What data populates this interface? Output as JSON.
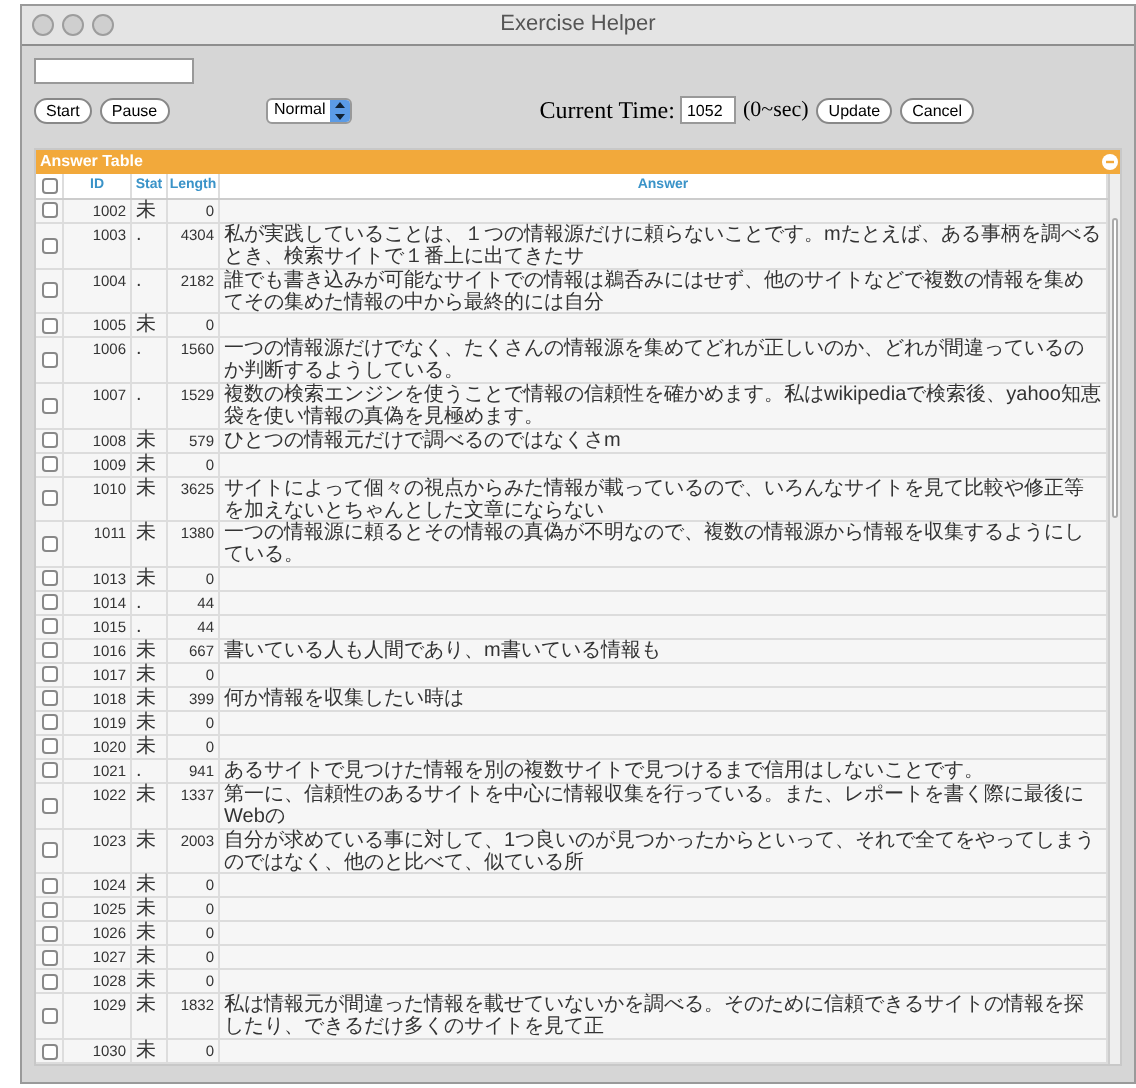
{
  "window": {
    "title": "Exercise Helper"
  },
  "controls": {
    "buttons_left": [
      "Start",
      "Pause"
    ],
    "speed_select": "Normal",
    "time_label": "Current Time:",
    "time_value": "1052",
    "time_unit": "(0~sec)",
    "buttons_right": [
      "Update",
      "Cancel"
    ]
  },
  "table": {
    "title": "Answer Table",
    "header_checked": false,
    "columns": [
      "ID",
      "Stat",
      "Length",
      "Answer"
    ],
    "rows": [
      {
        "checked": false,
        "id": "1002",
        "stat": "未",
        "length": "0",
        "answer": ""
      },
      {
        "checked": false,
        "id": "1003",
        "stat": ".",
        "length": "4304",
        "answer": "私が実践していることは、１つの情報源だけに頼らないことです。mたとえば、ある事柄を調べるとき、検索サイトで１番上に出てきたサ"
      },
      {
        "checked": false,
        "id": "1004",
        "stat": ".",
        "length": "2182",
        "answer": "誰でも書き込みが可能なサイトでの情報は鵜呑みにはせず、他のサイトなどで複数の情報を集めてその集めた情報の中から最終的には自分"
      },
      {
        "checked": false,
        "id": "1005",
        "stat": "未",
        "length": "0",
        "answer": ""
      },
      {
        "checked": false,
        "id": "1006",
        "stat": ".",
        "length": "1560",
        "answer": "一つの情報源だけでなく、たくさんの情報源を集めてどれが正しいのか、どれが間違っているのか判断するようしている。"
      },
      {
        "checked": false,
        "id": "1007",
        "stat": ".",
        "length": "1529",
        "answer": "複数の検索エンジンを使うことで情報の信頼性を確かめます。私はwikipediaで検索後、yahoo知恵袋を使い情報の真偽を見極めます。"
      },
      {
        "checked": false,
        "id": "1008",
        "stat": "未",
        "length": "579",
        "answer": "ひとつの情報元だけで調べるのではなくさm"
      },
      {
        "checked": false,
        "id": "1009",
        "stat": "未",
        "length": "0",
        "answer": ""
      },
      {
        "checked": false,
        "id": "1010",
        "stat": "未",
        "length": "3625",
        "answer": "サイトによって個々の視点からみた情報が載っているので、いろんなサイトを見て比較や修正等を加えないとちゃんとした文章にならない"
      },
      {
        "checked": false,
        "id": "1011",
        "stat": "未",
        "length": "1380",
        "answer": "一つの情報源に頼るとその情報の真偽が不明なので、複数の情報源から情報を収集するようにしている。"
      },
      {
        "checked": false,
        "id": "1013",
        "stat": "未",
        "length": "0",
        "answer": ""
      },
      {
        "checked": false,
        "id": "1014",
        "stat": ".",
        "length": "44",
        "answer": ""
      },
      {
        "checked": false,
        "id": "1015",
        "stat": ".",
        "length": "44",
        "answer": ""
      },
      {
        "checked": false,
        "id": "1016",
        "stat": "未",
        "length": "667",
        "answer": "書いている人も人間であり、m書いている情報も"
      },
      {
        "checked": false,
        "id": "1017",
        "stat": "未",
        "length": "0",
        "answer": ""
      },
      {
        "checked": false,
        "id": "1018",
        "stat": "未",
        "length": "399",
        "answer": "何か情報を収集したい時は"
      },
      {
        "checked": false,
        "id": "1019",
        "stat": "未",
        "length": "0",
        "answer": ""
      },
      {
        "checked": false,
        "id": "1020",
        "stat": "未",
        "length": "0",
        "answer": ""
      },
      {
        "checked": false,
        "id": "1021",
        "stat": ".",
        "length": "941",
        "answer": "あるサイトで見つけた情報を別の複数サイトで見つけるまで信用はしないことです。"
      },
      {
        "checked": false,
        "id": "1022",
        "stat": "未",
        "length": "1337",
        "answer": "第一に、信頼性のあるサイトを中心に情報収集を行っている。また、レポートを書く際に最後にWebの"
      },
      {
        "checked": false,
        "id": "1023",
        "stat": "未",
        "length": "2003",
        "answer": "自分が求めている事に対して、1つ良いのが見つかったからといって、それで全てをやってしまうのではなく、他のと比べて、似ている所"
      },
      {
        "checked": false,
        "id": "1024",
        "stat": "未",
        "length": "0",
        "answer": ""
      },
      {
        "checked": false,
        "id": "1025",
        "stat": "未",
        "length": "0",
        "answer": ""
      },
      {
        "checked": false,
        "id": "1026",
        "stat": "未",
        "length": "0",
        "answer": ""
      },
      {
        "checked": false,
        "id": "1027",
        "stat": "未",
        "length": "0",
        "answer": ""
      },
      {
        "checked": false,
        "id": "1028",
        "stat": "未",
        "length": "0",
        "answer": ""
      },
      {
        "checked": false,
        "id": "1029",
        "stat": "未",
        "length": "1832",
        "answer": "私は情報元が間違った情報を載せていないかを調べる。そのために信頼できるサイトの情報を探したり、できるだけ多くのサイトを見て正"
      },
      {
        "checked": false,
        "id": "1030",
        "stat": "未",
        "length": "0",
        "answer": ""
      }
    ]
  }
}
